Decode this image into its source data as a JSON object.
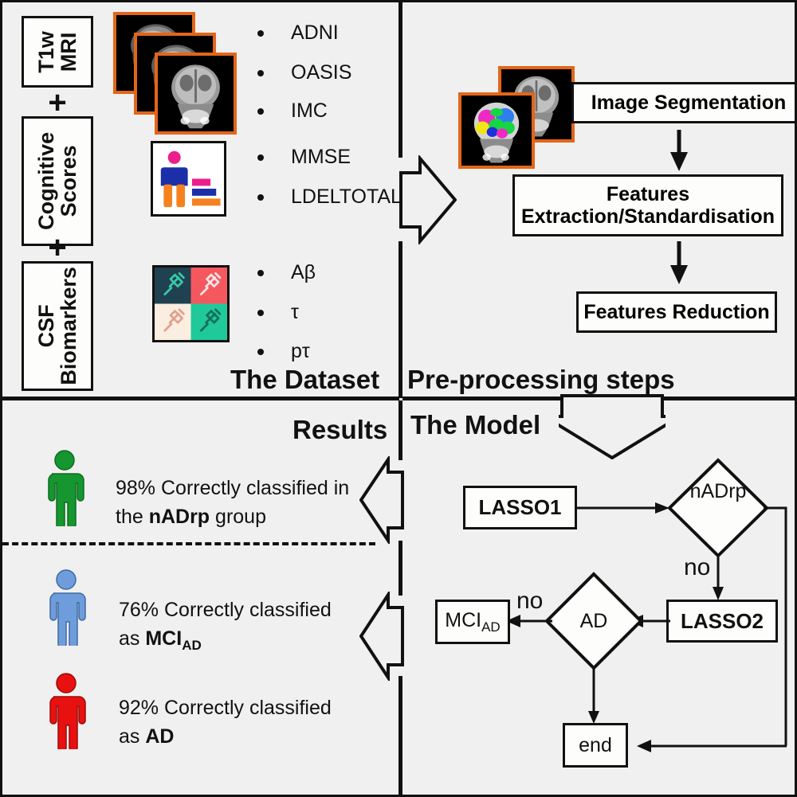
{
  "figure": {
    "title": "Alzheimer's disease classification pipeline overview",
    "background_color": "#f0f0f0",
    "accent_color": "#e2661a"
  },
  "panels": {
    "dataset": {
      "title": "The Dataset",
      "inputs": [
        {
          "label": "T1w\nMRI",
          "name": "t1w-mri"
        },
        {
          "label": "Cognitive\nScores",
          "name": "cognitive-scores"
        },
        {
          "label": "CSF\nBiomarkers",
          "name": "csf-biomarkers"
        }
      ],
      "input_lines": {
        "t1w_line1": "T1w",
        "t1w_line2": "MRI",
        "cog_line1": "Cognitive",
        "cog_line2": "Scores",
        "csf_line1": "CSF",
        "csf_line2": "Biomarkers"
      },
      "plus_symbol": "+",
      "cohort_bullets": [
        "ADNI",
        "OASIS",
        "IMC"
      ],
      "cognitive_bullets": [
        "MMSE",
        "LDELTOTAL"
      ],
      "biomarker_bullets": [
        "Aβ",
        "τ",
        "pτ"
      ],
      "icons": {
        "mri_stack": "mri-scan-stack-icon",
        "cognitive_chart": "cognitive-score-chart-icon",
        "syringe_grid": "csf-syringe-grid-icon"
      }
    },
    "preprocessing": {
      "title": "Pre-processing steps",
      "steps": [
        {
          "label": "Image Segmentation",
          "name": "image-segmentation"
        },
        {
          "label": "Features\nExtraction/Standardisation",
          "name": "features-extraction-standardisation"
        },
        {
          "label": "Features Reduction",
          "name": "features-reduction"
        }
      ],
      "step_lines": {
        "segmentation": "Image Segmentation",
        "extraction_line1": "Features",
        "extraction_line2": "Extraction/Standardisation",
        "reduction": "Features Reduction"
      },
      "icons": {
        "segmented_mri": "segmented-mri-stack-icon"
      }
    },
    "model": {
      "title": "The Model",
      "nodes": [
        {
          "id": "lasso1",
          "shape": "rect",
          "label": "LASSO1"
        },
        {
          "id": "nadrp",
          "shape": "diamond",
          "label": "nADrp"
        },
        {
          "id": "lasso2",
          "shape": "rect",
          "label": "LASSO2"
        },
        {
          "id": "ad",
          "shape": "diamond",
          "label": "AD"
        },
        {
          "id": "mci_ad",
          "shape": "rect",
          "label": "MCI",
          "sublabel": "AD"
        },
        {
          "id": "end",
          "shape": "rect",
          "label": "end"
        }
      ],
      "node_labels": {
        "lasso1": "LASSO1",
        "nadrp": "nADrp",
        "lasso2": "LASSO2",
        "ad": "AD",
        "mci_main": "MCI",
        "mci_sub": "AD",
        "end": "end"
      },
      "edge_labels": {
        "nadrp_no": "no",
        "ad_no": "no"
      }
    },
    "results": {
      "title": "Results",
      "items": [
        {
          "name": "result-nadrp",
          "color": "#15962f",
          "percent": "98%",
          "line1_prefix": "98% Correctly classified in",
          "line2_prefix": "the ",
          "line2_bold": "nADrp",
          "line2_suffix": " group",
          "group": "nADrp"
        },
        {
          "name": "result-mci-ad",
          "color": "#6f9ddb",
          "percent": "76%",
          "line1_prefix": "76% Correctly classified",
          "line2_prefix": "as ",
          "line2_bold": "MCI",
          "line2_sub": "AD",
          "line2_suffix": "",
          "group": "MCIAD"
        },
        {
          "name": "result-ad",
          "color": "#e8110f",
          "percent": "92%",
          "line1_prefix": "92% Correctly classified",
          "line2_prefix": "as ",
          "line2_bold": "AD",
          "line2_suffix": "",
          "group": "AD"
        }
      ],
      "icons": {
        "person": "person-figure-icon"
      }
    }
  },
  "connectors": {
    "dataset_to_preprocessing": "block-arrow-right",
    "preprocessing_to_model": "block-arrow-down",
    "model_to_results_top": "block-arrow-left",
    "model_to_results_bottom": "block-arrow-left"
  }
}
